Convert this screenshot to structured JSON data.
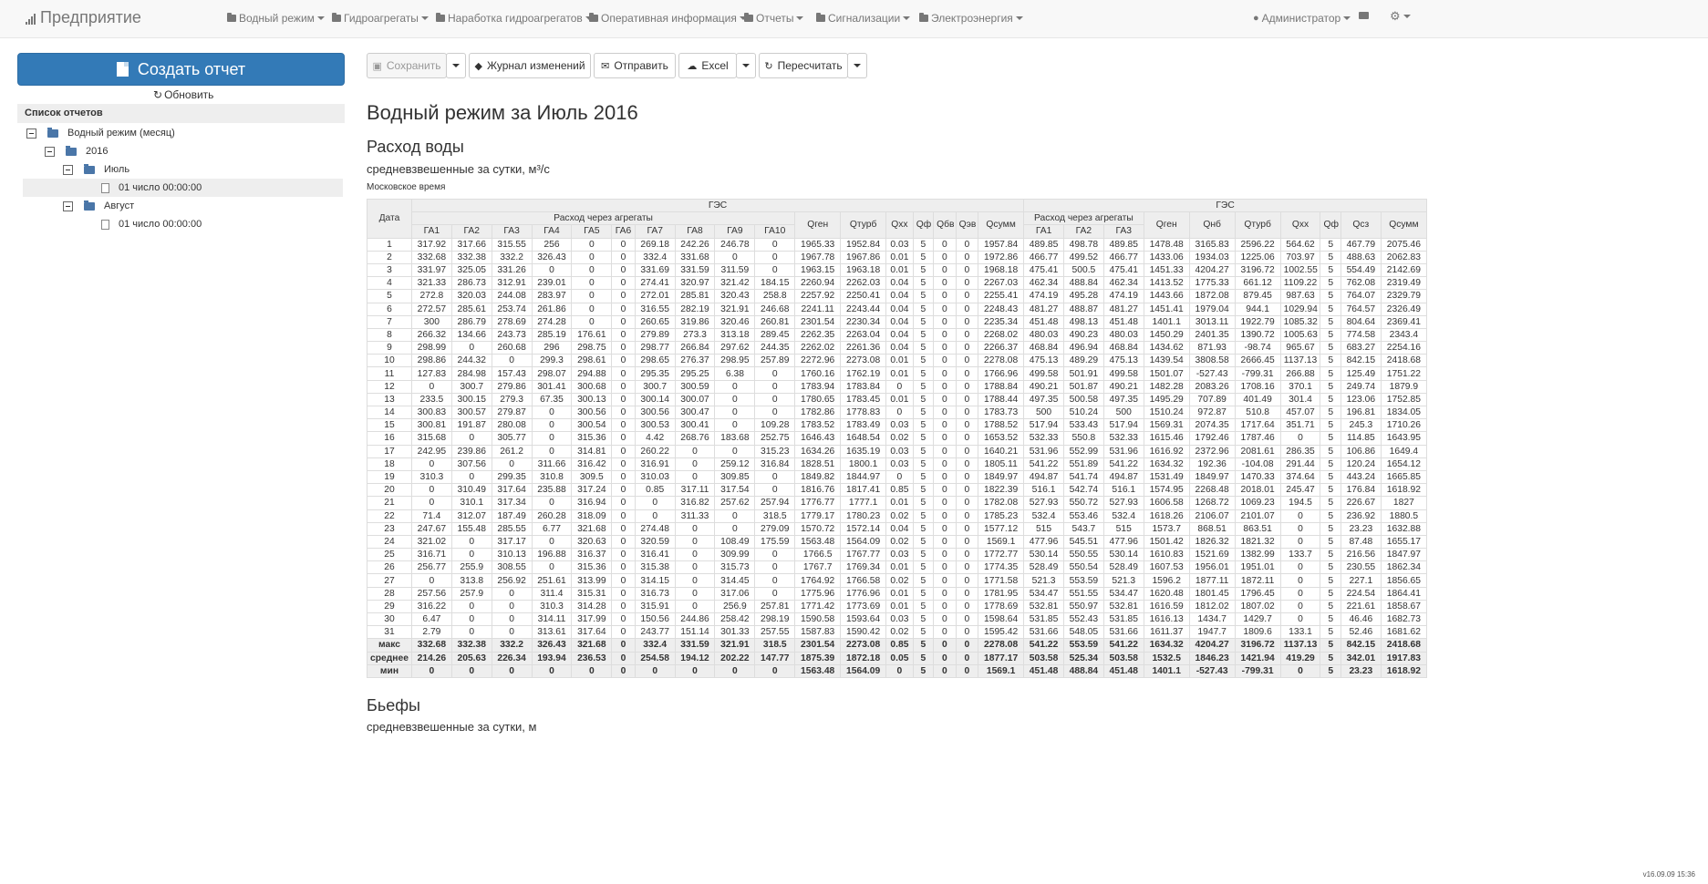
{
  "navbar": {
    "brand": "Предприятие",
    "items": [
      {
        "label": "Водный режим"
      },
      {
        "label": "Гидроагрегаты"
      },
      {
        "label": "Наработка гидроагрегатов"
      },
      {
        "label": "Оперативная информация"
      },
      {
        "label": "Отчеты"
      },
      {
        "label": "Сигнализации"
      },
      {
        "label": "Электроэнергия"
      }
    ],
    "user": "Администратор"
  },
  "sidebar": {
    "create_button": "Создать отчет",
    "refresh_label": "Обновить",
    "list_header": "Список отчетов",
    "tree": [
      {
        "label": "Водный режим (месяц)",
        "kind": "folder"
      },
      {
        "label": "2016",
        "kind": "folder"
      },
      {
        "label": "Июль",
        "kind": "folder"
      },
      {
        "label": "01 число 00:00:00",
        "kind": "doc",
        "selected": true
      },
      {
        "label": "Август",
        "kind": "folder"
      },
      {
        "label": "01 число 00:00:00",
        "kind": "doc",
        "selected": false
      }
    ]
  },
  "toolbar": {
    "save": "Сохранить",
    "journal": "Журнал изменений",
    "send": "Отправить",
    "excel": "Excel",
    "recalc": "Пересчитать"
  },
  "report": {
    "title": "Водный режим за Июль 2016",
    "section1_title": "Расход воды",
    "section1_sub": "средневзвешенные за сутки, м³/с",
    "timezone_note": "Московское время",
    "section2_title": "Бьефы",
    "section2_sub": "средневзвешенные за сутки, м"
  },
  "version": "v16.09.09 15:36",
  "table": {
    "date_header": "Дата",
    "group_left": "ГЭС",
    "group_right": "ГЭС",
    "agg_header_left": "Расход через агрегаты",
    "agg_header_right": "Расход через агрегаты",
    "left_cols": [
      "ГА1",
      "ГА2",
      "ГА3",
      "ГА4",
      "ГА5",
      "ГА6",
      "ГА7",
      "ГА8",
      "ГА9",
      "ГА10"
    ],
    "mid_cols": [
      "Qген",
      "Qтурб",
      "Qхх",
      "Qф",
      "Qбв",
      "Qэв",
      "Qсумм"
    ],
    "right_agg_cols": [
      "ГА1",
      "ГА2",
      "ГА3"
    ],
    "right_cols": [
      "Qген",
      "Qнб",
      "Qтурб",
      "Qхх",
      "Qф",
      "Qсз",
      "Qсумм"
    ],
    "rows": [
      [
        "1",
        "317.92",
        "317.66",
        "315.55",
        "256",
        "0",
        "0",
        "269.18",
        "242.26",
        "246.78",
        "0",
        "1965.33",
        "1952.84",
        "0.03",
        "5",
        "0",
        "0",
        "1957.84",
        "489.85",
        "498.78",
        "489.85",
        "1478.48",
        "3165.83",
        "2596.22",
        "564.62",
        "5",
        "467.79",
        "2075.46"
      ],
      [
        "2",
        "332.68",
        "332.38",
        "332.2",
        "326.43",
        "0",
        "0",
        "332.4",
        "331.68",
        "0",
        "0",
        "1967.78",
        "1967.86",
        "0.01",
        "5",
        "0",
        "0",
        "1972.86",
        "466.77",
        "499.52",
        "466.77",
        "1433.06",
        "1934.03",
        "1225.06",
        "703.97",
        "5",
        "488.63",
        "2062.83"
      ],
      [
        "3",
        "331.97",
        "325.05",
        "331.26",
        "0",
        "0",
        "0",
        "331.69",
        "331.59",
        "311.59",
        "0",
        "1963.15",
        "1963.18",
        "0.01",
        "5",
        "0",
        "0",
        "1968.18",
        "475.41",
        "500.5",
        "475.41",
        "1451.33",
        "4204.27",
        "3196.72",
        "1002.55",
        "5",
        "554.49",
        "2142.69"
      ],
      [
        "4",
        "321.33",
        "286.73",
        "312.91",
        "239.01",
        "0",
        "0",
        "274.41",
        "320.97",
        "321.42",
        "184.15",
        "2260.94",
        "2262.03",
        "0.04",
        "5",
        "0",
        "0",
        "2267.03",
        "462.34",
        "488.84",
        "462.34",
        "1413.52",
        "1775.33",
        "661.12",
        "1109.22",
        "5",
        "762.08",
        "2319.49"
      ],
      [
        "5",
        "272.8",
        "320.03",
        "244.08",
        "283.97",
        "0",
        "0",
        "272.01",
        "285.81",
        "320.43",
        "258.8",
        "2257.92",
        "2250.41",
        "0.04",
        "5",
        "0",
        "0",
        "2255.41",
        "474.19",
        "495.28",
        "474.19",
        "1443.66",
        "1872.08",
        "879.45",
        "987.63",
        "5",
        "764.07",
        "2329.79"
      ],
      [
        "6",
        "272.57",
        "285.61",
        "253.74",
        "261.86",
        "0",
        "0",
        "316.55",
        "282.19",
        "321.91",
        "246.68",
        "2241.11",
        "2243.44",
        "0.04",
        "5",
        "0",
        "0",
        "2248.43",
        "481.27",
        "488.87",
        "481.27",
        "1451.41",
        "1979.04",
        "944.1",
        "1029.94",
        "5",
        "764.57",
        "2326.49"
      ],
      [
        "7",
        "300",
        "286.79",
        "278.69",
        "274.28",
        "0",
        "0",
        "260.65",
        "319.86",
        "320.46",
        "260.81",
        "2301.54",
        "2230.34",
        "0.04",
        "5",
        "0",
        "0",
        "2235.34",
        "451.48",
        "498.13",
        "451.48",
        "1401.1",
        "3013.11",
        "1922.79",
        "1085.32",
        "5",
        "804.64",
        "2369.41"
      ],
      [
        "8",
        "266.32",
        "134.66",
        "243.73",
        "285.19",
        "176.61",
        "0",
        "279.89",
        "273.3",
        "313.18",
        "289.45",
        "2262.35",
        "2263.04",
        "0.04",
        "5",
        "0",
        "0",
        "2268.02",
        "480.03",
        "490.23",
        "480.03",
        "1450.29",
        "2401.35",
        "1390.72",
        "1005.63",
        "5",
        "774.58",
        "2343.4"
      ],
      [
        "9",
        "298.99",
        "0",
        "260.68",
        "296",
        "298.75",
        "0",
        "298.77",
        "266.84",
        "297.62",
        "244.35",
        "2262.02",
        "2261.36",
        "0.04",
        "5",
        "0",
        "0",
        "2266.37",
        "468.84",
        "496.94",
        "468.84",
        "1434.62",
        "871.93",
        "-98.74",
        "965.67",
        "5",
        "683.27",
        "2254.16"
      ],
      [
        "10",
        "298.86",
        "244.32",
        "0",
        "299.3",
        "298.61",
        "0",
        "298.65",
        "276.37",
        "298.95",
        "257.89",
        "2272.96",
        "2273.08",
        "0.01",
        "5",
        "0",
        "0",
        "2278.08",
        "475.13",
        "489.29",
        "475.13",
        "1439.54",
        "3808.58",
        "2666.45",
        "1137.13",
        "5",
        "842.15",
        "2418.68"
      ],
      [
        "11",
        "127.83",
        "284.98",
        "157.43",
        "298.07",
        "294.88",
        "0",
        "295.35",
        "295.25",
        "6.38",
        "0",
        "1760.16",
        "1762.19",
        "0.01",
        "5",
        "0",
        "0",
        "1766.96",
        "499.58",
        "501.91",
        "499.58",
        "1501.07",
        "-527.43",
        "-799.31",
        "266.88",
        "5",
        "125.49",
        "1751.22"
      ],
      [
        "12",
        "0",
        "300.7",
        "279.86",
        "301.41",
        "300.68",
        "0",
        "300.7",
        "300.59",
        "0",
        "0",
        "1783.94",
        "1783.84",
        "0",
        "5",
        "0",
        "0",
        "1788.84",
        "490.21",
        "501.87",
        "490.21",
        "1482.28",
        "2083.26",
        "1708.16",
        "370.1",
        "5",
        "249.74",
        "1879.9"
      ],
      [
        "13",
        "233.5",
        "300.15",
        "279.3",
        "67.35",
        "300.13",
        "0",
        "300.14",
        "300.07",
        "0",
        "0",
        "1780.65",
        "1783.45",
        "0.01",
        "5",
        "0",
        "0",
        "1788.44",
        "497.35",
        "500.58",
        "497.35",
        "1495.29",
        "707.89",
        "401.49",
        "301.4",
        "5",
        "123.06",
        "1752.85"
      ],
      [
        "14",
        "300.83",
        "300.57",
        "279.87",
        "0",
        "300.56",
        "0",
        "300.56",
        "300.47",
        "0",
        "0",
        "1782.86",
        "1778.83",
        "0",
        "5",
        "0",
        "0",
        "1783.73",
        "500",
        "510.24",
        "500",
        "1510.24",
        "972.87",
        "510.8",
        "457.07",
        "5",
        "196.81",
        "1834.05"
      ],
      [
        "15",
        "300.81",
        "191.87",
        "280.08",
        "0",
        "300.54",
        "0",
        "300.53",
        "300.41",
        "0",
        "109.28",
        "1783.52",
        "1783.49",
        "0.03",
        "5",
        "0",
        "0",
        "1788.52",
        "517.94",
        "533.43",
        "517.94",
        "1569.31",
        "2074.35",
        "1717.64",
        "351.71",
        "5",
        "245.3",
        "1710.26"
      ],
      [
        "16",
        "315.68",
        "0",
        "305.77",
        "0",
        "315.36",
        "0",
        "4.42",
        "268.76",
        "183.68",
        "252.75",
        "1646.43",
        "1648.54",
        "0.02",
        "5",
        "0",
        "0",
        "1653.52",
        "532.33",
        "550.8",
        "532.33",
        "1615.46",
        "1792.46",
        "1787.46",
        "0",
        "5",
        "114.85",
        "1643.95"
      ],
      [
        "17",
        "242.95",
        "239.86",
        "261.2",
        "0",
        "314.81",
        "0",
        "260.22",
        "0",
        "0",
        "315.23",
        "1634.26",
        "1635.19",
        "0.03",
        "5",
        "0",
        "0",
        "1640.21",
        "531.96",
        "552.99",
        "531.96",
        "1616.92",
        "2372.96",
        "2081.61",
        "286.35",
        "5",
        "106.86",
        "1649.4"
      ],
      [
        "18",
        "0",
        "307.56",
        "0",
        "311.66",
        "316.42",
        "0",
        "316.91",
        "0",
        "259.12",
        "316.84",
        "1828.51",
        "1800.1",
        "0.03",
        "5",
        "0",
        "0",
        "1805.11",
        "541.22",
        "551.89",
        "541.22",
        "1634.32",
        "192.36",
        "-104.08",
        "291.44",
        "5",
        "120.24",
        "1654.12"
      ],
      [
        "19",
        "310.3",
        "0",
        "299.35",
        "310.8",
        "309.5",
        "0",
        "310.03",
        "0",
        "309.85",
        "0",
        "1849.82",
        "1844.97",
        "0",
        "5",
        "0",
        "0",
        "1849.97",
        "494.87",
        "541.74",
        "494.87",
        "1531.49",
        "1849.97",
        "1470.33",
        "374.64",
        "5",
        "443.24",
        "1665.85"
      ],
      [
        "20",
        "0",
        "310.49",
        "317.64",
        "235.88",
        "317.24",
        "0",
        "0.85",
        "317.11",
        "317.54",
        "0",
        "1816.76",
        "1817.41",
        "0.85",
        "5",
        "0",
        "0",
        "1822.39",
        "516.1",
        "542.74",
        "516.1",
        "1574.95",
        "2268.48",
        "2018.01",
        "245.47",
        "5",
        "176.84",
        "1618.92"
      ],
      [
        "21",
        "0",
        "310.1",
        "317.34",
        "0",
        "316.94",
        "0",
        "0",
        "316.82",
        "257.62",
        "257.94",
        "1776.77",
        "1777.1",
        "0.01",
        "5",
        "0",
        "0",
        "1782.08",
        "527.93",
        "550.72",
        "527.93",
        "1606.58",
        "1268.72",
        "1069.23",
        "194.5",
        "5",
        "226.67",
        "1827"
      ],
      [
        "22",
        "71.4",
        "312.07",
        "187.49",
        "260.28",
        "318.09",
        "0",
        "0",
        "311.33",
        "0",
        "318.5",
        "1779.17",
        "1780.23",
        "0.02",
        "5",
        "0",
        "0",
        "1785.23",
        "532.4",
        "553.46",
        "532.4",
        "1618.26",
        "2106.07",
        "2101.07",
        "0",
        "5",
        "236.92",
        "1880.5"
      ],
      [
        "23",
        "247.67",
        "155.48",
        "285.55",
        "6.77",
        "321.68",
        "0",
        "274.48",
        "0",
        "0",
        "279.09",
        "1570.72",
        "1572.14",
        "0.04",
        "5",
        "0",
        "0",
        "1577.12",
        "515",
        "543.7",
        "515",
        "1573.7",
        "868.51",
        "863.51",
        "0",
        "5",
        "23.23",
        "1632.88"
      ],
      [
        "24",
        "321.02",
        "0",
        "317.17",
        "0",
        "320.63",
        "0",
        "320.59",
        "0",
        "108.49",
        "175.59",
        "1563.48",
        "1564.09",
        "0.02",
        "5",
        "0",
        "0",
        "1569.1",
        "477.96",
        "545.51",
        "477.96",
        "1501.42",
        "1826.32",
        "1821.32",
        "0",
        "5",
        "87.48",
        "1655.17"
      ],
      [
        "25",
        "316.71",
        "0",
        "310.13",
        "196.88",
        "316.37",
        "0",
        "316.41",
        "0",
        "309.99",
        "0",
        "1766.5",
        "1767.77",
        "0.03",
        "5",
        "0",
        "0",
        "1772.77",
        "530.14",
        "550.55",
        "530.14",
        "1610.83",
        "1521.69",
        "1382.99",
        "133.7",
        "5",
        "216.56",
        "1847.97"
      ],
      [
        "26",
        "256.77",
        "255.9",
        "308.55",
        "0",
        "315.36",
        "0",
        "315.38",
        "0",
        "315.73",
        "0",
        "1767.7",
        "1769.34",
        "0.01",
        "5",
        "0",
        "0",
        "1774.35",
        "528.49",
        "550.54",
        "528.49",
        "1607.53",
        "1956.01",
        "1951.01",
        "0",
        "5",
        "230.55",
        "1862.34"
      ],
      [
        "27",
        "0",
        "313.8",
        "256.92",
        "251.61",
        "313.99",
        "0",
        "314.15",
        "0",
        "314.45",
        "0",
        "1764.92",
        "1766.58",
        "0.02",
        "5",
        "0",
        "0",
        "1771.58",
        "521.3",
        "553.59",
        "521.3",
        "1596.2",
        "1877.11",
        "1872.11",
        "0",
        "5",
        "227.1",
        "1856.65"
      ],
      [
        "28",
        "257.56",
        "257.9",
        "0",
        "311.4",
        "315.31",
        "0",
        "316.73",
        "0",
        "317.06",
        "0",
        "1775.96",
        "1776.96",
        "0.01",
        "5",
        "0",
        "0",
        "1781.95",
        "534.47",
        "551.55",
        "534.47",
        "1620.48",
        "1801.45",
        "1796.45",
        "0",
        "5",
        "224.54",
        "1864.41"
      ],
      [
        "29",
        "316.22",
        "0",
        "0",
        "310.3",
        "314.28",
        "0",
        "315.91",
        "0",
        "256.9",
        "257.81",
        "1771.42",
        "1773.69",
        "0.01",
        "5",
        "0",
        "0",
        "1778.69",
        "532.81",
        "550.97",
        "532.81",
        "1616.59",
        "1812.02",
        "1807.02",
        "0",
        "5",
        "221.61",
        "1858.67"
      ],
      [
        "30",
        "6.47",
        "0",
        "0",
        "314.11",
        "317.99",
        "0",
        "150.56",
        "244.86",
        "258.42",
        "298.19",
        "1590.58",
        "1593.64",
        "0.03",
        "5",
        "0",
        "0",
        "1598.64",
        "531.85",
        "552.43",
        "531.85",
        "1616.13",
        "1434.7",
        "1429.7",
        "0",
        "5",
        "46.46",
        "1682.73"
      ],
      [
        "31",
        "2.79",
        "0",
        "0",
        "313.61",
        "317.64",
        "0",
        "243.77",
        "151.14",
        "301.33",
        "257.55",
        "1587.83",
        "1590.42",
        "0.02",
        "5",
        "0",
        "0",
        "1595.42",
        "531.66",
        "548.05",
        "531.66",
        "1611.37",
        "1947.7",
        "1809.6",
        "133.1",
        "5",
        "52.46",
        "1681.62"
      ]
    ],
    "summary": [
      [
        "макс",
        "332.68",
        "332.38",
        "332.2",
        "326.43",
        "321.68",
        "0",
        "332.4",
        "331.59",
        "321.91",
        "318.5",
        "2301.54",
        "2273.08",
        "0.85",
        "5",
        "0",
        "0",
        "2278.08",
        "541.22",
        "553.59",
        "541.22",
        "1634.32",
        "4204.27",
        "3196.72",
        "1137.13",
        "5",
        "842.15",
        "2418.68"
      ],
      [
        "среднее",
        "214.26",
        "205.63",
        "226.34",
        "193.94",
        "236.53",
        "0",
        "254.58",
        "194.12",
        "202.22",
        "147.77",
        "1875.39",
        "1872.18",
        "0.05",
        "5",
        "0",
        "0",
        "1877.17",
        "503.58",
        "525.34",
        "503.58",
        "1532.5",
        "1846.23",
        "1421.94",
        "419.29",
        "5",
        "342.01",
        "1917.83"
      ],
      [
        "мин",
        "0",
        "0",
        "0",
        "0",
        "0",
        "0",
        "0",
        "0",
        "0",
        "0",
        "1563.48",
        "1564.09",
        "0",
        "5",
        "0",
        "0",
        "1569.1",
        "451.48",
        "488.84",
        "451.48",
        "1401.1",
        "-527.43",
        "-799.31",
        "0",
        "5",
        "23.23",
        "1618.92"
      ]
    ]
  }
}
